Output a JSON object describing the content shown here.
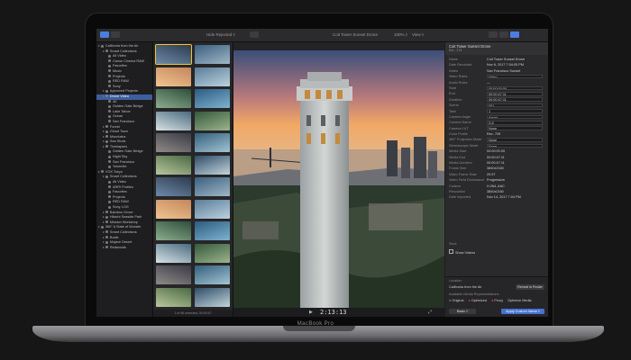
{
  "device": {
    "label": "MacBook Pro"
  },
  "toolbar": {
    "filter": "Hide Rejected ◊",
    "project": "Coit Tower Sunset Drone",
    "zoom": "100% ◊",
    "view": "View ◊",
    "inspector_title": "Coit Tower Sunset Drone"
  },
  "sidebar": {
    "items": [
      {
        "label": "California from the Air",
        "level": 0
      },
      {
        "label": "Smart Collections",
        "level": 1
      },
      {
        "label": "All Video",
        "level": 2
      },
      {
        "label": "Canon Cinema RAW",
        "level": 2
      },
      {
        "label": "Favorites",
        "level": 2
      },
      {
        "label": "Music",
        "level": 2
      },
      {
        "label": "Projects",
        "level": 2
      },
      {
        "label": "RED RAW",
        "level": 2
      },
      {
        "label": "Sony",
        "level": 2
      },
      {
        "label": "Approved Projects",
        "level": 1
      },
      {
        "label": "Drone Video",
        "level": 1,
        "selected": true
      },
      {
        "label": "4K",
        "level": 2
      },
      {
        "label": "Golden Gate Bridge",
        "level": 2
      },
      {
        "label": "Lake Tahoe",
        "level": 2
      },
      {
        "label": "Ocean",
        "level": 2
      },
      {
        "label": "San Francisco",
        "level": 2
      },
      {
        "label": "Forest",
        "level": 1
      },
      {
        "label": "Ghost Town",
        "level": 1
      },
      {
        "label": "Mountains",
        "level": 1
      },
      {
        "label": "Sea Shots",
        "level": 1
      },
      {
        "label": "Timelapses",
        "level": 1
      },
      {
        "label": "Golden Gate Bridge",
        "level": 2
      },
      {
        "label": "Night Sky",
        "level": 2
      },
      {
        "label": "San Francisco",
        "level": 2
      },
      {
        "label": "Yosemite",
        "level": 2
      },
      {
        "label": "VOX Tokyo",
        "level": 0
      },
      {
        "label": "Smart Collections",
        "level": 1
      },
      {
        "label": "All Video",
        "level": 2
      },
      {
        "label": "ARRI Profiles",
        "level": 2
      },
      {
        "label": "Favorites",
        "level": 2
      },
      {
        "label": "Projects",
        "level": 2
      },
      {
        "label": "RED RAW",
        "level": 2
      },
      {
        "label": "Sony LOG",
        "level": 2
      },
      {
        "label": "Bamboo Grove",
        "level": 1
      },
      {
        "label": "Hitachi Seaside Park",
        "level": 1
      },
      {
        "label": "Mission Workshop",
        "level": 1
      },
      {
        "label": "360° A State of Wonder",
        "level": 0
      },
      {
        "label": "Smart Collections",
        "level": 1
      },
      {
        "label": "Bodie",
        "level": 1
      },
      {
        "label": "Mojave Desert",
        "level": 1
      },
      {
        "label": "Redwoods",
        "level": 1
      }
    ]
  },
  "browser": {
    "footer": "1 of 96 selected, 00:00:47"
  },
  "viewer": {
    "timecode": "2:13:13"
  },
  "inspector": {
    "clip_name": "Coit Tower Sunset Drone",
    "sub": "Ext - 174",
    "rows": [
      {
        "k": "Name",
        "v": "Coit Tower Sunset Drone",
        "box": false
      },
      {
        "k": "Date Recorded",
        "v": "Nov 6, 2017 7:04:05 PM",
        "box": false
      },
      {
        "k": "Notes",
        "v": "San Francisco Sunset",
        "box": false
      },
      {
        "k": "Video Roles",
        "v": "Video",
        "box": true
      },
      {
        "k": "Audio Roles",
        "v": "—",
        "box": false
      },
      {
        "k": "Start",
        "v": "00:00:00:00",
        "box": true
      },
      {
        "k": "End",
        "v": "00:00:47:11",
        "box": true
      },
      {
        "k": "Duration",
        "v": "00:00:47:11",
        "box": true
      },
      {
        "k": "Scene",
        "v": "001",
        "box": true
      },
      {
        "k": "Take",
        "v": "1",
        "box": true
      },
      {
        "k": "Camera Angle",
        "v": "Aerial",
        "box": true
      },
      {
        "k": "Camera Name",
        "v": "DJI",
        "box": true
      },
      {
        "k": "Camera LUT",
        "v": "None",
        "box": true
      },
      {
        "k": "Color Profile",
        "v": "Rec. 709",
        "box": false
      },
      {
        "k": "360° Projection Mode",
        "v": "None",
        "box": true
      },
      {
        "k": "Stereoscopic Mode",
        "v": "None",
        "box": true
      },
      {
        "k": "Media Start",
        "v": "00:00:00:00",
        "box": false
      },
      {
        "k": "Media End",
        "v": "00:00:47:11",
        "box": false
      },
      {
        "k": "Media Duration",
        "v": "00:00:47:11",
        "box": false
      },
      {
        "k": "Frame Size",
        "v": "3840x2160",
        "box": false
      },
      {
        "k": "Video Frame Rate",
        "v": "29.97",
        "box": false
      },
      {
        "k": "Video Field Dominance",
        "v": "Progressive",
        "box": false
      },
      {
        "k": "Codecs",
        "v": "H.264, AAC",
        "box": false
      },
      {
        "k": "Resolution",
        "v": "3840x2160",
        "box": false
      },
      {
        "k": "Date Imported",
        "v": "Nov 14, 2017 7:04 PM",
        "box": false
      }
    ],
    "send_label": "Send",
    "show_videos": "Show Videos",
    "location_label": "Location",
    "location_value": "California from the Air",
    "reveal_button": "Reveal in Finder",
    "available_label": "Available Media Representations",
    "rep_original": "Original",
    "rep_optimized": "Optimized",
    "rep_proxy": "Proxy",
    "rep_missing": "Optimize Media",
    "basic_button": "Basic ◊",
    "apply_button": "Apply Custom Name ◊"
  },
  "colors": {
    "selection": "#3e5e9c",
    "accent_yellow": "#f4c430",
    "button_blue": "#4572d0"
  }
}
